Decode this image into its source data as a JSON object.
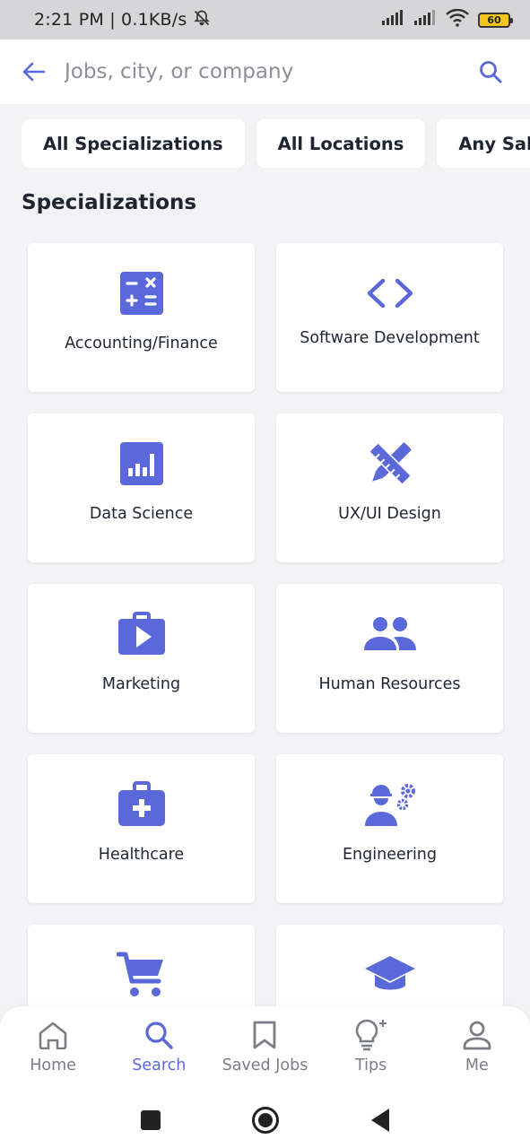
{
  "status_bar": {
    "time": "2:21 PM | 0.1KB/s",
    "battery": "60"
  },
  "search": {
    "placeholder": "Jobs, city, or company"
  },
  "filters": [
    "All Specializations",
    "All Locations",
    "Any Salary"
  ],
  "section_title": "Specializations",
  "specializations": [
    {
      "label": "Accounting/Finance",
      "icon": "calculator-icon"
    },
    {
      "label": "Software Development",
      "icon": "code-icon"
    },
    {
      "label": "Data Science",
      "icon": "bar-chart-icon"
    },
    {
      "label": "UX/UI Design",
      "icon": "design-tools-icon"
    },
    {
      "label": "Marketing",
      "icon": "briefcase-play-icon"
    },
    {
      "label": "Human Resources",
      "icon": "people-icon"
    },
    {
      "label": "Healthcare",
      "icon": "medical-kit-icon"
    },
    {
      "label": "Engineering",
      "icon": "engineer-icon"
    },
    {
      "label": "",
      "icon": "shopping-cart-icon"
    },
    {
      "label": "",
      "icon": "graduation-cap-icon"
    }
  ],
  "bottom_nav": [
    {
      "label": "Home",
      "icon": "home-icon",
      "active": false
    },
    {
      "label": "Search",
      "icon": "search-icon",
      "active": true
    },
    {
      "label": "Saved Jobs",
      "icon": "bookmark-icon",
      "active": false
    },
    {
      "label": "Tips",
      "icon": "lightbulb-icon",
      "active": false
    },
    {
      "label": "Me",
      "icon": "user-icon",
      "active": false
    }
  ],
  "colors": {
    "accent": "#5b68d9",
    "icon_primary": "#5b68d9",
    "nav_inactive": "#7a7d85",
    "text": "#1f2530",
    "background": "#f3f3f5"
  }
}
